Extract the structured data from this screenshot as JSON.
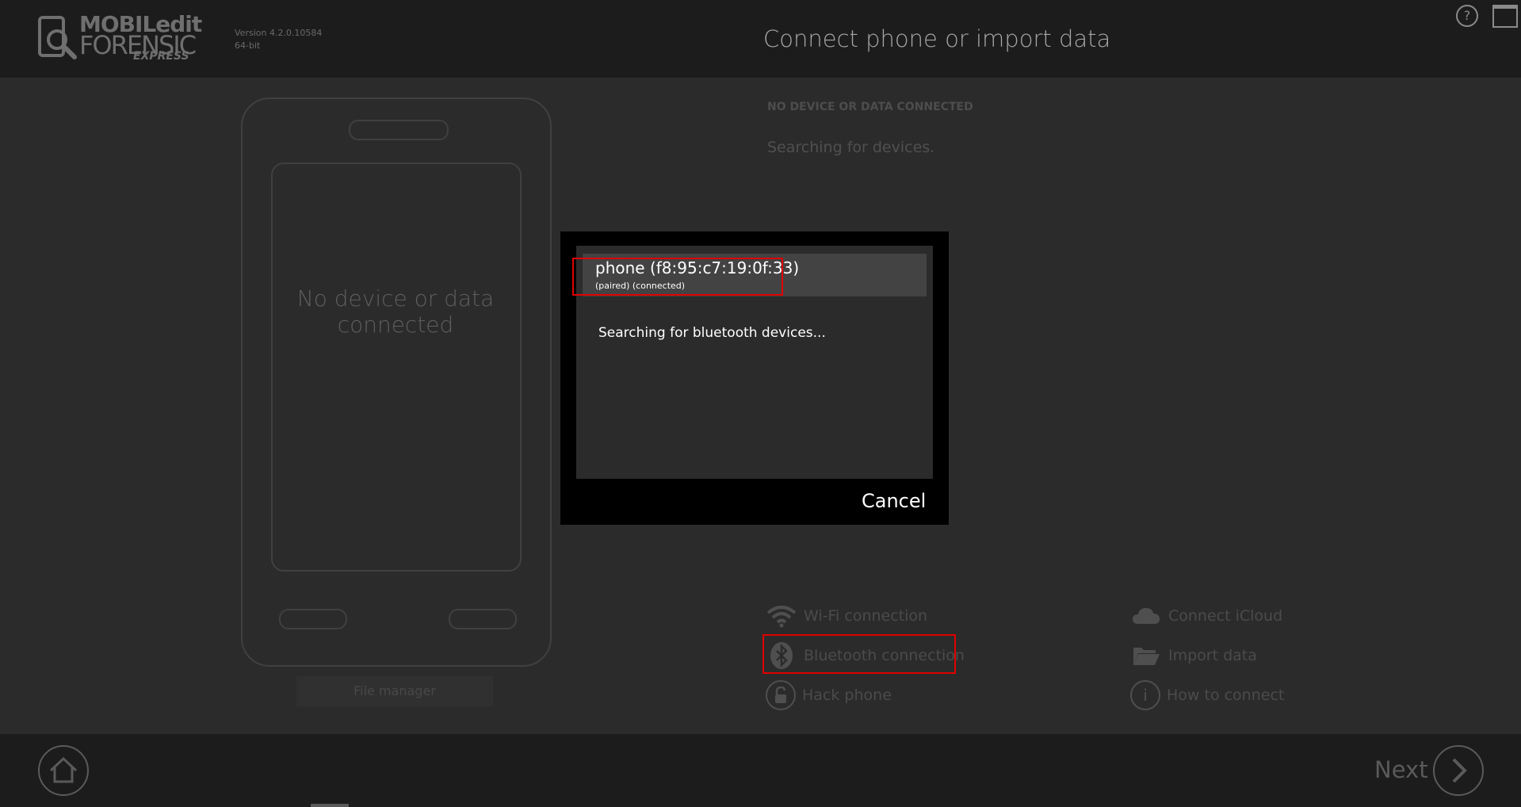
{
  "app": {
    "logo_line1": "MOBILedit",
    "logo_line2": "FORENSIC",
    "logo_line3": "EXPRESS",
    "version_line1": "Version 4.2.0.10584",
    "version_line2": "64-bit",
    "title": "Connect phone or import data",
    "help_label": "?"
  },
  "left_panel": {
    "phone_text": "No device or data connected",
    "file_manager": "File manager"
  },
  "status": {
    "label": "NO DEVICE OR DATA CONNECTED",
    "text": "Searching for devices."
  },
  "options": {
    "wifi": "Wi-Fi connection",
    "bluetooth": "Bluetooth connection",
    "hack": "Hack phone",
    "icloud": "Connect iCloud",
    "import": "Import data",
    "howto": "How to connect",
    "info_glyph": "i"
  },
  "footer": {
    "next": "Next"
  },
  "dialog": {
    "device_name": "phone (f8:95:c7:19:0f:33)",
    "device_status": "(paired) (connected)",
    "searching": "Searching for bluetooth devices...",
    "cancel": "Cancel"
  }
}
